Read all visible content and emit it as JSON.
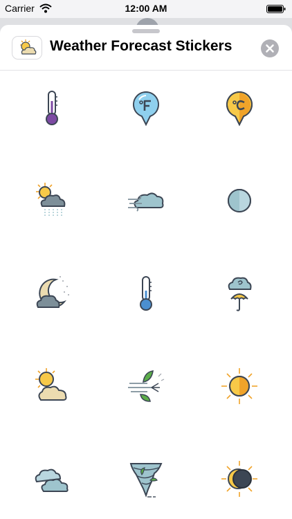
{
  "status_bar": {
    "carrier": "Carrier",
    "time": "12:00 AM",
    "wifi_icon": "wifi-icon",
    "battery_icon": "battery-icon"
  },
  "sheet": {
    "title": "Weather Forecast Stickers",
    "app_icon": "sun-cloud-app-icon",
    "close_icon": "close-icon"
  },
  "stickers": [
    {
      "name": "thermometer-purple-sticker"
    },
    {
      "name": "fahrenheit-pin-sticker"
    },
    {
      "name": "celsius-pin-sticker"
    },
    {
      "name": "sun-cloud-rain-sticker"
    },
    {
      "name": "wind-cloud-sticker"
    },
    {
      "name": "moon-full-sticker"
    },
    {
      "name": "night-moon-cloud-sticker"
    },
    {
      "name": "thermometer-blue-sticker"
    },
    {
      "name": "cloud-umbrella-sticker"
    },
    {
      "name": "sun-cloud-sticker"
    },
    {
      "name": "wind-leaves-sticker"
    },
    {
      "name": "sun-bright-sticker"
    },
    {
      "name": "clouds-sticker"
    },
    {
      "name": "tornado-sticker"
    },
    {
      "name": "eclipse-sticker"
    }
  ],
  "colors": {
    "sheet_background": "#ffffff",
    "screen_background": "#f4f4f6",
    "outline": "#3c4654",
    "sun_yellow": "#f7c948",
    "sun_orange": "#f0a32a",
    "cloud_blue": "#9ec4cd",
    "cloud_gray": "#7d8f99",
    "cloud_tan": "#ecdcb0",
    "pin_blue": "#8fd0ee",
    "purple": "#7d4aa3",
    "leaf_green": "#5cae4a"
  }
}
